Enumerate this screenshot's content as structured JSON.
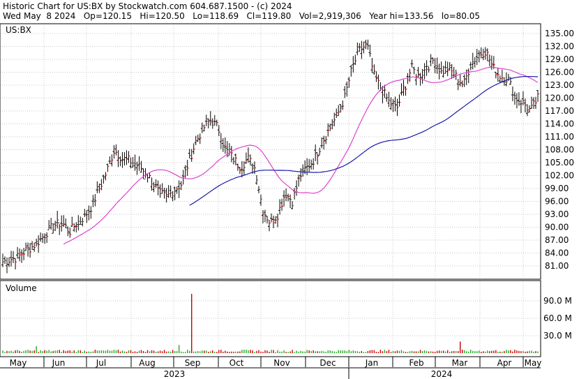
{
  "header": {
    "line1": "Historic Chart for US:BX by Stockwatch.com 604.687.1500 - (c) 2024",
    "line2": "Wed May  8 2024   Op=120.15   Hi=120.50   Lo=118.69   Cl=119.80   Vol=2,919,306   Year hi=133.56   lo=80.05"
  },
  "price_panel": {
    "label": "US:BX"
  },
  "volume_panel": {
    "label": "Volume"
  },
  "colors": {
    "bar": "#000000",
    "close_tick": "#cc0000",
    "ma_short": "#dd44cc",
    "ma_long": "#1a1aaa",
    "volume": "#22aa22",
    "volume_down": "#cc0000"
  },
  "chart_data": {
    "type": "ohlc",
    "price_axis": {
      "ticks": [
        135,
        132,
        129,
        126,
        123,
        120,
        117,
        114,
        111,
        108,
        105,
        102,
        99,
        96,
        93,
        90,
        87,
        84,
        81
      ],
      "labels": [
        "135.00",
        "132.00",
        "129.00",
        "126.00",
        "123.00",
        "120.00",
        "117.00",
        "114.00",
        "111.00",
        "108.00",
        "105.00",
        "102.00",
        "99.00",
        "96.00",
        "93.00",
        "90.00",
        "87.00",
        "84.00",
        "81.00"
      ]
    },
    "volume_axis": {
      "ticks": [
        30,
        60,
        90
      ],
      "labels": [
        "30.0 M",
        "60.0 M",
        "90.0 M"
      ]
    },
    "months": [
      "May",
      "Jun",
      "Jul",
      "Aug",
      "Sep",
      "Oct",
      "Nov",
      "Dec",
      "Jan",
      "Feb",
      "Mar",
      "Apr",
      "May"
    ],
    "years": [
      "2023",
      "2024"
    ],
    "weekly_close": [
      82,
      82.5,
      83,
      84.5,
      85.5,
      87,
      89,
      90.5,
      91,
      89,
      91,
      92.5,
      95,
      99,
      103,
      108,
      106,
      105.5,
      104.5,
      103,
      101,
      98,
      97,
      98.5,
      100,
      105,
      110,
      113,
      115,
      113,
      108,
      106,
      104,
      106,
      103.5,
      94,
      91,
      93,
      98,
      96,
      102,
      104,
      106,
      110,
      113,
      116,
      120,
      127,
      131,
      132.5,
      125,
      122,
      119,
      117.5,
      122,
      127,
      125,
      127,
      129,
      126,
      127,
      125,
      123,
      128,
      130,
      131,
      127,
      125,
      124.5,
      120,
      119,
      117,
      120
    ]
  }
}
